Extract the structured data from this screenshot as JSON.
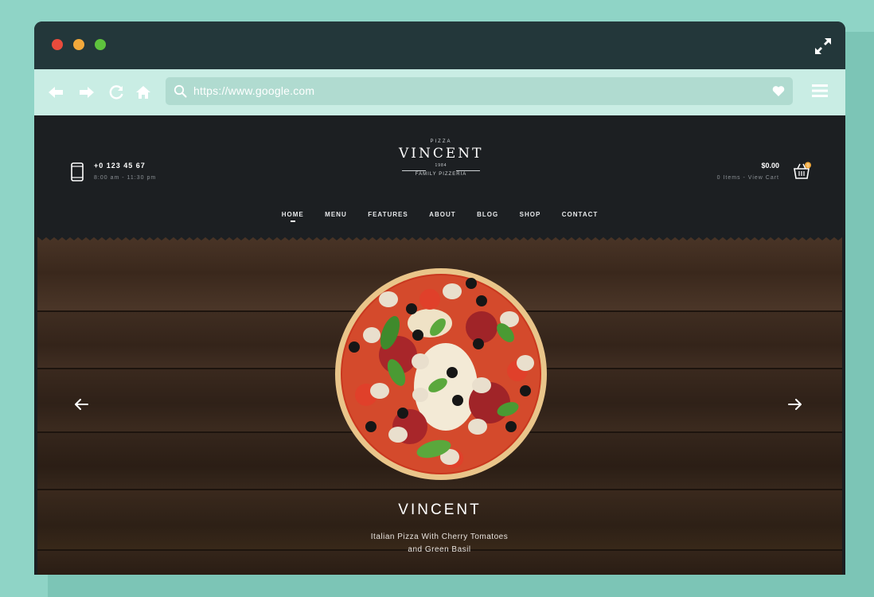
{
  "browser": {
    "url": "https://www.google.com"
  },
  "site": {
    "phone": "+0 123 45 67",
    "hours": "8:00 am - 11:30 pm",
    "logo": {
      "top": "PIZZA",
      "name": "VINCENT",
      "year": "1984",
      "sub": "FAMILY PIZZERIA"
    },
    "cart": {
      "total": "$0.00",
      "items": "0 Items - View Cart",
      "badge": "0"
    },
    "nav": [
      "HOME",
      "MENU",
      "FEATURES",
      "ABOUT",
      "BLOG",
      "SHOP",
      "CONTACT"
    ],
    "hero": {
      "title": "VINCENT",
      "subtitle_line1": "Italian Pizza With Cherry Tomatoes",
      "subtitle_line2": "and Green Basil"
    }
  }
}
